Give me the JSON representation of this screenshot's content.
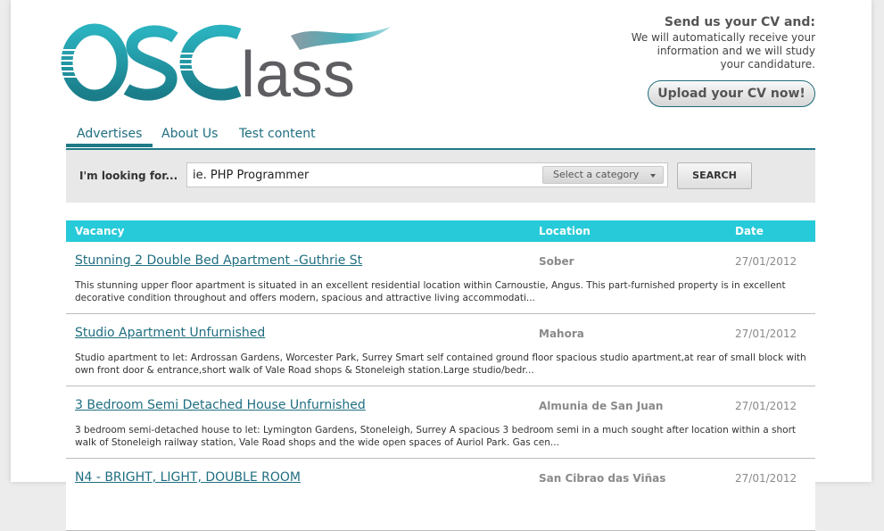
{
  "brand": {
    "logo_text": "OSClass",
    "colors": {
      "teal": "#1f8a96",
      "teal_light": "#2ab5c2",
      "gray": "#5a5a5a",
      "header_bg": "#27cad9"
    }
  },
  "cv": {
    "title": "Send us your CV and:",
    "line1": "We will automatically receive your",
    "line2": "information and we will study",
    "line3": "your candidature.",
    "button": "Upload your CV now!"
  },
  "nav": {
    "items": [
      {
        "label": "Advertises",
        "active": true
      },
      {
        "label": "About Us",
        "active": false
      },
      {
        "label": "Test content",
        "active": false
      }
    ]
  },
  "search": {
    "label": "I'm looking for...",
    "value": "ie. PHP Programmer",
    "category": "Select a category",
    "button": "SEARCH"
  },
  "table": {
    "headers": {
      "vacancy": "Vacancy",
      "location": "Location",
      "date": "Date"
    },
    "rows": [
      {
        "title": "Stunning 2 Double Bed Apartment -Guthrie St",
        "location": "Sober",
        "date": "27/01/2012",
        "description": "This stunning upper floor apartment is situated in an excellent residential location within Carnoustie, Angus. This part-furnished property is in excellent decorative condition throughout and offers modern, spacious and attractive living accommodati..."
      },
      {
        "title": "Studio Apartment Unfurnished",
        "location": "Mahora",
        "date": "27/01/2012",
        "description": "Studio apartment to let: Ardrossan Gardens, Worcester Park, Surrey Smart self contained ground floor spacious studio apartment,at rear of small block with own front door & entrance,short walk of Vale Road shops & Stoneleigh station.Large studio/bedr..."
      },
      {
        "title": "3 Bedroom Semi Detached House Unfurnished",
        "location": "Almunia de San Juan",
        "date": "27/01/2012",
        "description": "3 bedroom semi-detached house to let: Lymington Gardens, Stoneleigh, Surrey A spacious 3 bedroom semi in a much sought after location within a short walk of Stoneleigh railway station, Vale Road shops and the wide open spaces of Auriol Park. Gas cen..."
      },
      {
        "title": "N4 - BRIGHT, LIGHT, DOUBLE ROOM",
        "location": "San Cibrao das Viñas",
        "date": "27/01/2012",
        "description": ""
      }
    ]
  }
}
